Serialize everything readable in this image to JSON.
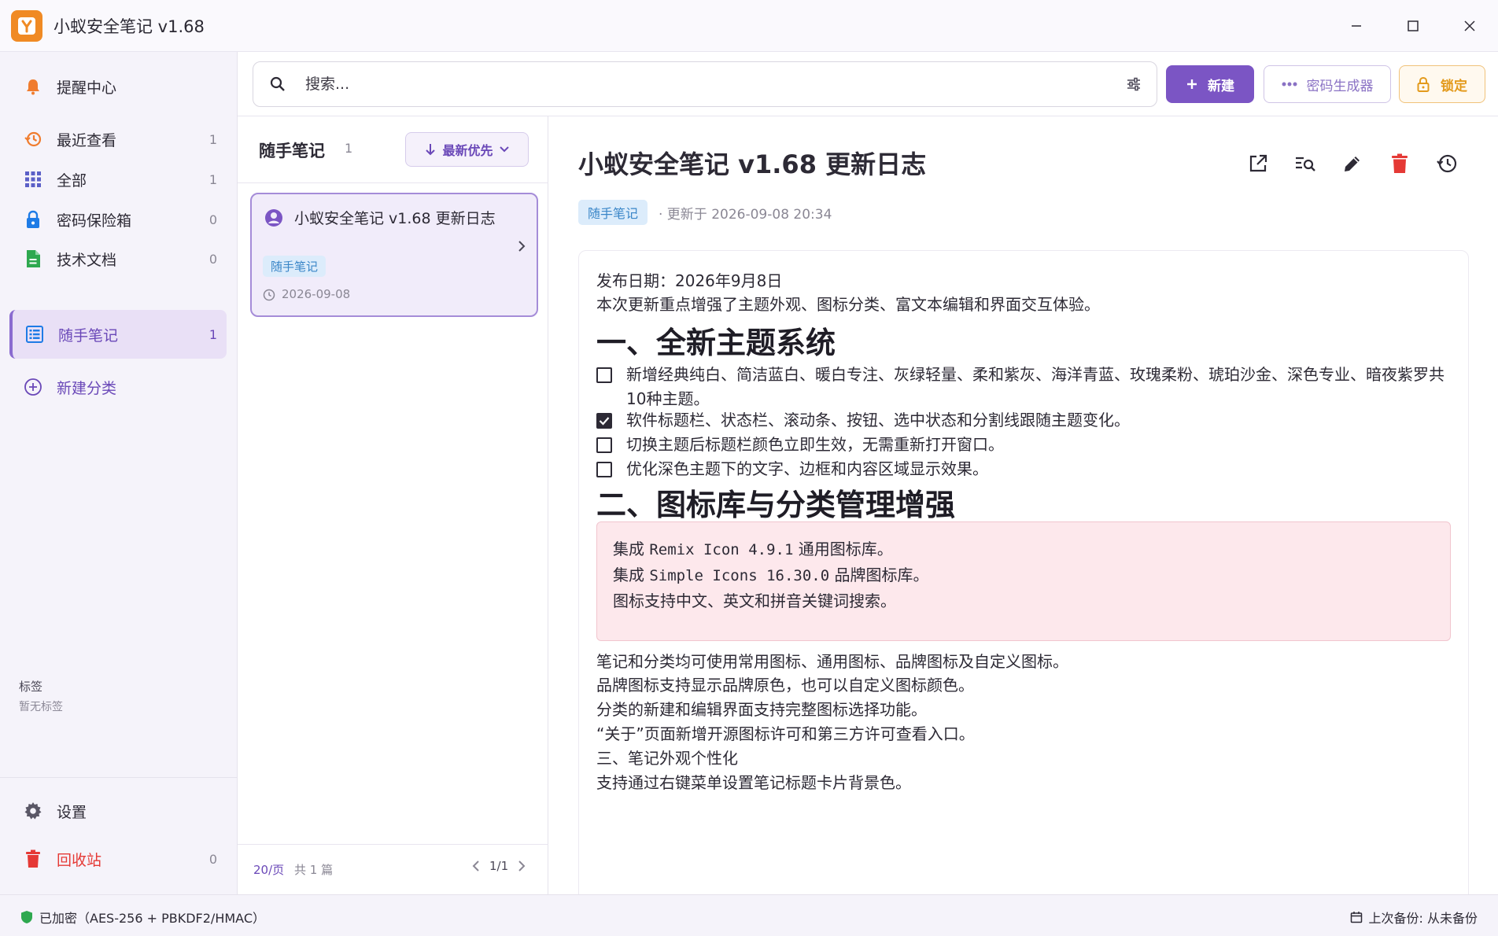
{
  "window": {
    "title": "小蚁安全笔记 v1.68"
  },
  "sidebar": {
    "items": [
      {
        "label": "提醒中心",
        "count": "",
        "icon": "bell-icon",
        "color": "#f07c2e"
      },
      {
        "label": "最近查看",
        "count": "1",
        "icon": "history-icon",
        "color": "#f07c2e"
      },
      {
        "label": "全部",
        "count": "1",
        "icon": "grid-icon",
        "color": "#5b5fc7"
      },
      {
        "label": "密码保险箱",
        "count": "0",
        "icon": "lock-icon",
        "color": "#1e7be6"
      },
      {
        "label": "技术文档",
        "count": "0",
        "icon": "document-icon",
        "color": "#2ea84f"
      },
      {
        "label": "随手笔记",
        "count": "1",
        "icon": "list-icon",
        "color": "#1e7be6"
      }
    ],
    "new_category": "新建分类",
    "tags_title": "标签",
    "tags_empty": "暂无标签",
    "settings": "设置",
    "trash": "回收站",
    "trash_count": "0"
  },
  "toolbar": {
    "search_placeholder": "搜索...",
    "new_label": "新建",
    "password_gen_label": "密码生成器",
    "lock_label": "锁定"
  },
  "list": {
    "title": "随手笔记",
    "count": "1",
    "sort_label": "最新优先",
    "notes": [
      {
        "title": "小蚁安全笔记 v1.68 更新日志",
        "tag": "随手笔记",
        "date": "2026-09-08"
      }
    ],
    "per_page": "20/页",
    "total": "共 1 篇",
    "page": "1/1"
  },
  "detail": {
    "title": "小蚁安全笔记 v1.68 更新日志",
    "tag": "随手笔记",
    "updated": "· 更新于 2026-09-08 20:34",
    "release_date": "发布日期：2026年9月8日",
    "intro": "本次更新重点增强了主题外观、图标分类、富文本编辑和界面交互体验。",
    "heading1": "一、全新主题系统",
    "checklist": [
      {
        "text": "新增经典纯白、简洁蓝白、暖白专注、灰绿轻量、柔和紫灰、海洋青蓝、玫瑰柔粉、琥珀沙金、深色专业、暗夜紫罗共10种主题。",
        "checked": false
      },
      {
        "text": "软件标题栏、状态栏、滚动条、按钮、选中状态和分割线跟随主题变化。",
        "checked": true
      },
      {
        "text": "切换主题后标题栏颜色立即生效，无需重新打开窗口。",
        "checked": false
      },
      {
        "text": "优化深色主题下的文字、边框和内容区域显示效果。",
        "checked": false
      }
    ],
    "heading2": "二、图标库与分类管理增强",
    "code_lines": [
      {
        "pre": "集成 ",
        "mono": "Remix Icon 4.9.1",
        "post": " 通用图标库。"
      },
      {
        "pre": "集成 ",
        "mono": "Simple Icons 16.30.0",
        "post": " 品牌图标库。"
      },
      {
        "pre": "图标支持中文、英文和拼音关键词搜索。",
        "mono": "",
        "post": ""
      }
    ],
    "paragraphs": [
      "笔记和分类均可使用常用图标、通用图标、品牌图标及自定义图标。",
      "品牌图标支持显示品牌原色，也可以自定义图标颜色。",
      "分类的新建和编辑界面支持完整图标选择功能。",
      "“关于”页面新增开源图标许可和第三方许可查看入口。",
      "三、笔记外观个性化",
      "支持通过右键菜单设置笔记标题卡片背景色。"
    ]
  },
  "status": {
    "encryption": "已加密（AES-256 + PBKDF2/HMAC）",
    "backup": "上次备份: 从未备份"
  },
  "colors": {
    "accent": "#7b55c4",
    "lock": "#e39a1c",
    "danger": "#e53935",
    "tag_bg": "#dcecfb"
  }
}
